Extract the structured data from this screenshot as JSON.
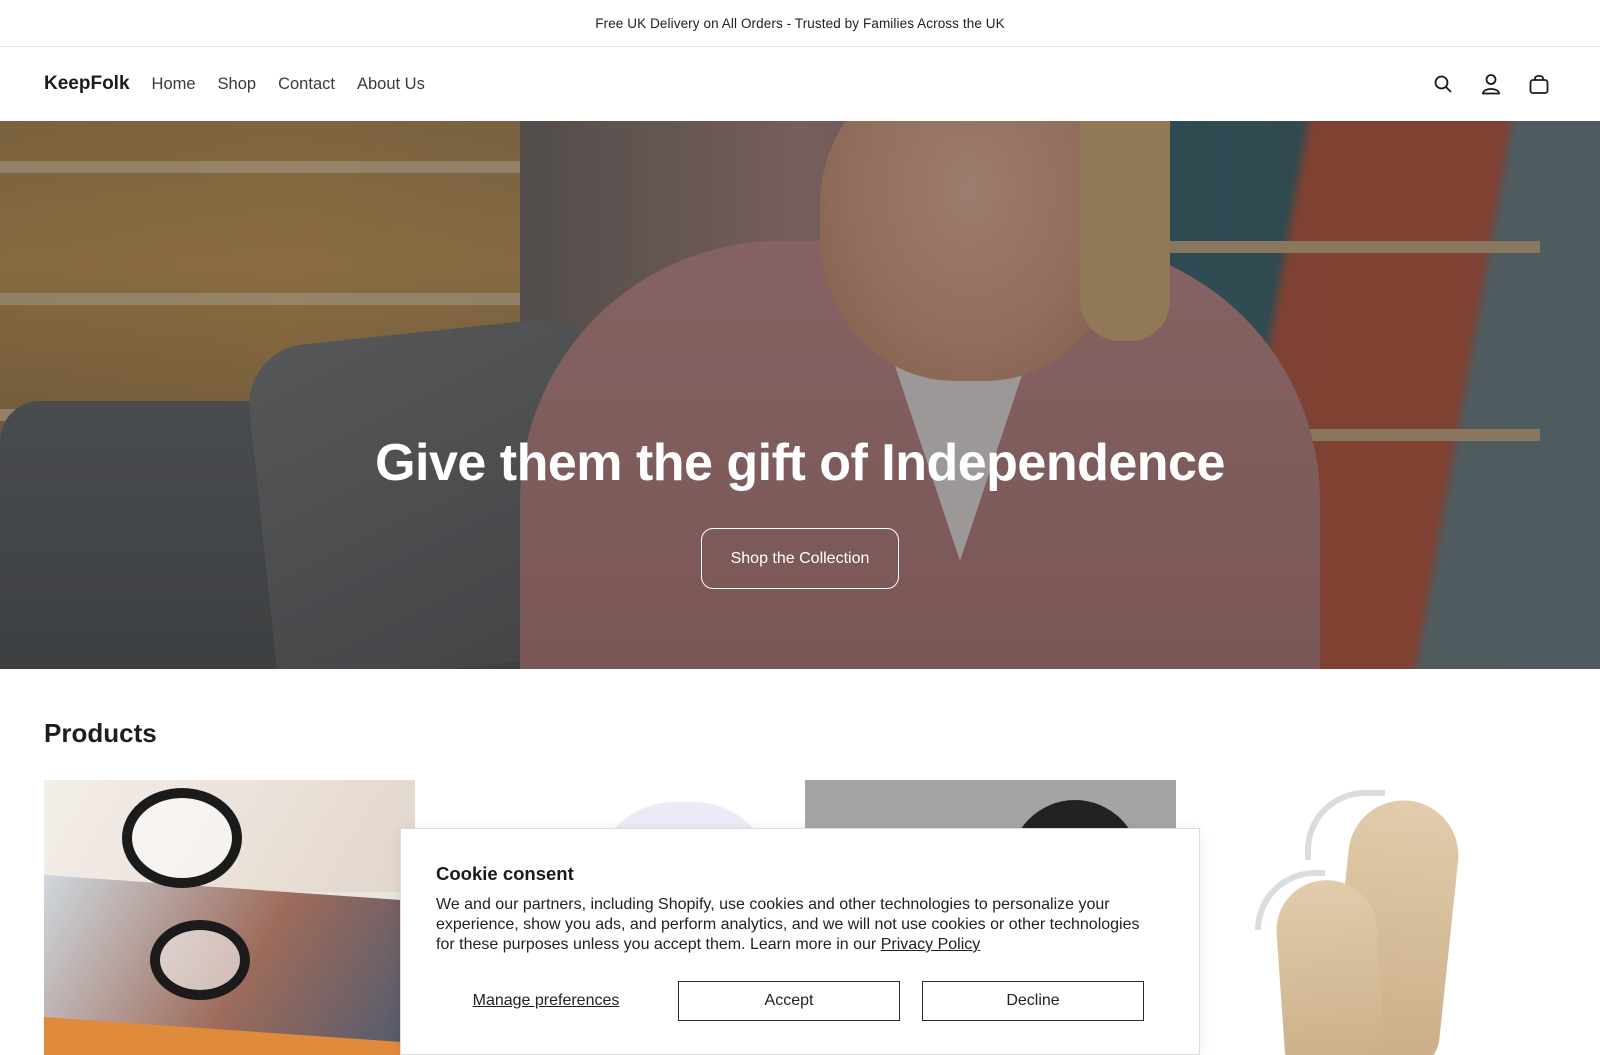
{
  "announcement": {
    "text": "Free UK Delivery on All Orders - Trusted by Families Across the UK"
  },
  "header": {
    "logo": "KeepFolk",
    "nav": [
      {
        "label": "Home"
      },
      {
        "label": "Shop"
      },
      {
        "label": "Contact"
      },
      {
        "label": "About Us"
      }
    ],
    "icons": [
      "search-icon",
      "account-icon",
      "cart-icon"
    ]
  },
  "hero": {
    "title": "Give them the gift of Independence",
    "button_label": "Shop the Collection"
  },
  "products": {
    "title": "Products"
  },
  "cookie_banner": {
    "title": "Cookie consent",
    "text": "We and our partners, including Shopify, use cookies and other technologies to personalize your experience, show you ads, and perform analytics, and we will not use cookies or other technologies for these purposes unless you accept them. Learn more in our",
    "link_label": "Privacy Policy",
    "manage_label": "Manage preferences",
    "accept_label": "Accept",
    "decline_label": "Decline"
  },
  "colors": {
    "text": "#121212",
    "border": "#e6e6e6",
    "hero_text": "#ffffff"
  }
}
